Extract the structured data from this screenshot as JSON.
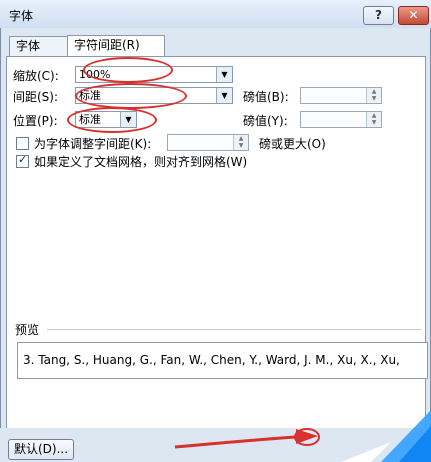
{
  "window": {
    "title": "字体"
  },
  "titlebar": {
    "help_label": "?",
    "close_label": "✕"
  },
  "tabs": [
    {
      "label": "字体"
    },
    {
      "label": "字符间距(R)"
    }
  ],
  "form": {
    "scale_label": "缩放(C):",
    "scale_value": "100%",
    "spacing_label": "间距(S):",
    "spacing_value": "标准",
    "spacing_by_label": "磅值(B):",
    "position_label": "位置(P):",
    "position_value": "标准",
    "position_by_label": "磅值(Y):",
    "kerning_label": "为字体调整字间距(K):",
    "kerning_suffix": "磅或更大(O)",
    "grid_label": "如果定义了文档网格，则对齐到网格(W)",
    "kerning_checked": false,
    "grid_checked": true
  },
  "preview": {
    "section_label": "预览",
    "text": "3. Tang, S., Huang, G., Fan, W., Chen, Y., Ward, J. M., Xu, X., Xu,"
  },
  "footer": {
    "default_label": "默认(D)..."
  },
  "colors": {
    "annotation": "#d7322e"
  },
  "icons": [
    "help-icon",
    "close-icon",
    "dropdown-arrow-icon",
    "spin-up-icon",
    "spin-down-icon",
    "checkbox-icon",
    "arrow-annotation-icon"
  ]
}
